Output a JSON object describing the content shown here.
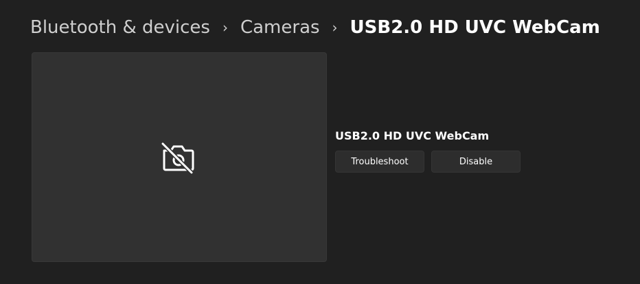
{
  "breadcrumb": {
    "items": [
      "Bluetooth & devices",
      "Cameras",
      "USB2.0 HD UVC WebCam"
    ],
    "separator": "›"
  },
  "camera": {
    "preview_icon": "camera-off-icon",
    "name": "USB2.0 HD UVC WebCam"
  },
  "actions": {
    "troubleshoot_label": "Troubleshoot",
    "disable_label": "Disable"
  },
  "colors": {
    "background": "#202020",
    "preview_background": "#313131",
    "button_background": "#2d2d2d",
    "text_primary": "#ffffff",
    "text_secondary": "#cfcfcf"
  }
}
